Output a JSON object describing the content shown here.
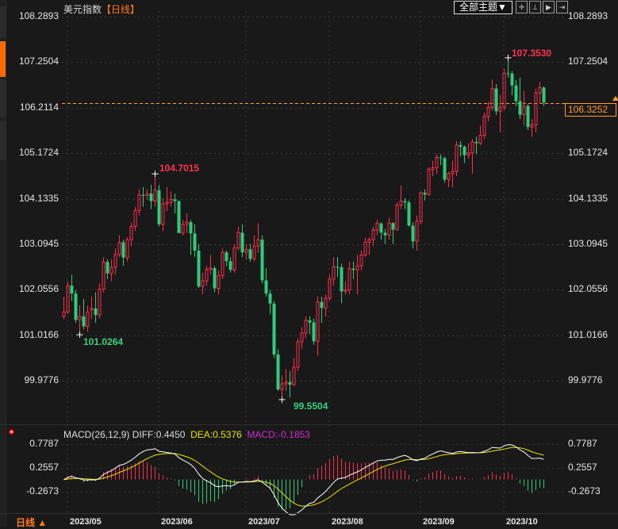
{
  "header": {
    "title": "美元指数",
    "period": "【日线】",
    "theme_button": "全部主题▼",
    "tools": [
      {
        "icon": "crosshair-icon"
      },
      {
        "icon": "fit-range-icon"
      },
      {
        "icon": "play-step-icon"
      },
      {
        "icon": "exit-right-icon"
      }
    ]
  },
  "price_axis": {
    "labels": [
      "108.2893",
      "107.2504",
      "106.2114",
      "105.1724",
      "104.1335",
      "103.0945",
      "102.0556",
      "101.0166",
      "99.9776"
    ]
  },
  "last_price": "106.3252",
  "annotations": {
    "high_may": "104.7015",
    "low_may": "101.0264",
    "low_jul": "99.5504",
    "high_oct": "107.3530"
  },
  "macd": {
    "title": "MACD(26,12,9)",
    "diff": "DIFF:0.4450",
    "dea": "DEA:0.5376",
    "macd": "MACD:-0.1853",
    "axis_labels": [
      "0.7787",
      "0.2557",
      "-0.2673"
    ]
  },
  "dates": {
    "months": [
      "2023/05",
      "2023/06",
      "2023/07",
      "2023/08",
      "2023/09",
      "2023/10"
    ]
  },
  "period_tab": "日线 ▲",
  "colors": {
    "up": "#ff2d4a",
    "down": "#2ecc7a",
    "accent": "#ff7a1a",
    "diff": "#ffffff",
    "dea": "#e6e600",
    "macd": "#d22ad2"
  },
  "chart_data": {
    "type": "candlestick",
    "title": "美元指数",
    "ylim": [
      99.9776,
      108.2893
    ],
    "columns": [
      "open",
      "high",
      "low",
      "close"
    ],
    "candles": [
      [
        101.45,
        101.9,
        101.38,
        101.55
      ],
      [
        101.55,
        102.25,
        101.5,
        102.15
      ],
      [
        102.15,
        102.4,
        101.8,
        101.97
      ],
      [
        101.97,
        102.05,
        101.3,
        101.37
      ],
      [
        101.37,
        101.7,
        101.03,
        101.45
      ],
      [
        101.45,
        101.85,
        101.15,
        101.22
      ],
      [
        101.22,
        101.7,
        101.1,
        101.55
      ],
      [
        101.6,
        101.9,
        101.4,
        101.63
      ],
      [
        101.63,
        102.0,
        101.3,
        101.48
      ],
      [
        101.48,
        102.2,
        101.4,
        102.07
      ],
      [
        102.07,
        102.8,
        102.0,
        102.69
      ],
      [
        102.69,
        102.75,
        102.3,
        102.43
      ],
      [
        102.43,
        102.75,
        102.25,
        102.57
      ],
      [
        102.57,
        103.0,
        102.4,
        102.86
      ],
      [
        102.86,
        103.3,
        102.8,
        103.14
      ],
      [
        103.14,
        103.2,
        102.6,
        102.79
      ],
      [
        102.79,
        103.25,
        102.7,
        103.2
      ],
      [
        103.2,
        103.6,
        103.05,
        103.5
      ],
      [
        103.5,
        103.95,
        103.4,
        103.86
      ],
      [
        103.86,
        104.35,
        103.75,
        104.22
      ],
      [
        104.22,
        104.4,
        103.95,
        104.21
      ],
      [
        104.21,
        104.35,
        104.1,
        104.25
      ],
      [
        104.25,
        104.45,
        103.9,
        104.08
      ],
      [
        104.08,
        104.7,
        103.95,
        104.33
      ],
      [
        104.33,
        104.45,
        103.5,
        103.55
      ],
      [
        103.55,
        104.15,
        103.4,
        104.02
      ],
      [
        104.02,
        104.4,
        103.85,
        104.05
      ],
      [
        104.05,
        104.3,
        103.95,
        104.12
      ],
      [
        104.12,
        104.25,
        103.8,
        104.08
      ],
      [
        104.08,
        104.1,
        103.35,
        103.35
      ],
      [
        103.35,
        103.65,
        103.3,
        103.55
      ],
      [
        103.55,
        103.8,
        103.35,
        103.6
      ],
      [
        103.6,
        103.65,
        102.85,
        103.34
      ],
      [
        103.34,
        103.55,
        102.8,
        102.95
      ],
      [
        102.95,
        103.1,
        102.1,
        102.13
      ],
      [
        102.13,
        102.45,
        101.95,
        102.26
      ],
      [
        102.26,
        102.6,
        102.15,
        102.52
      ],
      [
        102.52,
        102.85,
        102.4,
        102.55
      ],
      [
        102.55,
        102.6,
        102.0,
        102.09
      ],
      [
        102.09,
        102.5,
        101.95,
        102.38
      ],
      [
        102.38,
        103.0,
        102.3,
        102.91
      ],
      [
        102.91,
        102.95,
        102.6,
        102.71
      ],
      [
        102.71,
        102.8,
        102.45,
        102.51
      ],
      [
        102.51,
        103.1,
        102.45,
        103.01
      ],
      [
        103.01,
        103.5,
        102.95,
        103.36
      ],
      [
        103.36,
        103.55,
        102.8,
        102.91
      ],
      [
        102.91,
        103.1,
        102.75,
        102.98
      ],
      [
        102.98,
        103.1,
        102.7,
        102.76
      ],
      [
        102.76,
        103.3,
        102.7,
        103.05
      ],
      [
        103.05,
        103.57,
        102.9,
        103.2
      ],
      [
        103.2,
        103.3,
        102.2,
        102.27
      ],
      [
        102.27,
        102.55,
        101.9,
        101.97
      ],
      [
        101.97,
        102.05,
        101.5,
        101.74
      ],
      [
        101.74,
        101.8,
        100.5,
        100.58
      ],
      [
        100.58,
        100.7,
        99.75,
        99.78
      ],
      [
        99.78,
        100.1,
        99.55,
        99.91
      ],
      [
        99.91,
        100.25,
        99.75,
        99.95
      ],
      [
        99.95,
        100.2,
        99.6,
        99.89
      ],
      [
        99.89,
        100.5,
        99.85,
        100.29
      ],
      [
        100.29,
        100.95,
        100.2,
        100.87
      ],
      [
        100.87,
        101.2,
        100.7,
        101.07
      ],
      [
        101.07,
        101.45,
        100.95,
        101.36
      ],
      [
        101.36,
        101.45,
        101.05,
        101.31
      ],
      [
        101.31,
        101.4,
        100.8,
        100.88
      ],
      [
        100.88,
        101.9,
        100.55,
        101.78
      ],
      [
        101.78,
        101.9,
        101.3,
        101.64
      ],
      [
        101.64,
        101.95,
        101.45,
        101.86
      ],
      [
        101.86,
        102.4,
        101.8,
        102.3
      ],
      [
        102.3,
        102.8,
        102.15,
        102.58
      ],
      [
        102.58,
        102.8,
        102.35,
        102.57
      ],
      [
        102.57,
        102.65,
        101.75,
        102.02
      ],
      [
        102.02,
        102.25,
        101.95,
        102.05
      ],
      [
        102.05,
        102.7,
        101.95,
        102.54
      ],
      [
        102.54,
        102.7,
        102.3,
        102.51
      ],
      [
        102.51,
        102.85,
        101.95,
        102.6
      ],
      [
        102.6,
        102.95,
        102.5,
        102.85
      ],
      [
        102.85,
        103.25,
        102.8,
        103.14
      ],
      [
        103.14,
        103.25,
        102.85,
        103.2
      ],
      [
        103.2,
        103.5,
        103.05,
        103.42
      ],
      [
        103.42,
        103.65,
        103.3,
        103.57
      ],
      [
        103.57,
        103.6,
        103.2,
        103.36
      ],
      [
        103.36,
        103.45,
        103.1,
        103.3
      ],
      [
        103.3,
        103.7,
        103.2,
        103.58
      ],
      [
        103.58,
        103.6,
        103.1,
        103.43
      ],
      [
        103.43,
        104.05,
        103.4,
        103.99
      ],
      [
        103.99,
        104.44,
        103.9,
        104.08
      ],
      [
        104.08,
        104.15,
        103.9,
        104.05
      ],
      [
        104.05,
        104.1,
        103.5,
        103.52
      ],
      [
        103.52,
        103.6,
        103.0,
        103.16
      ],
      [
        103.16,
        103.75,
        102.95,
        103.62
      ],
      [
        103.62,
        104.3,
        103.55,
        104.27
      ],
      [
        104.27,
        104.35,
        104.1,
        104.23
      ],
      [
        104.23,
        104.85,
        104.2,
        104.8
      ],
      [
        104.8,
        105.0,
        104.65,
        104.84
      ],
      [
        104.84,
        105.15,
        104.7,
        105.08
      ],
      [
        105.08,
        105.15,
        104.9,
        105.06
      ],
      [
        105.06,
        105.1,
        104.5,
        104.57
      ],
      [
        104.57,
        104.75,
        104.4,
        104.71
      ],
      [
        104.71,
        105.0,
        104.4,
        104.76
      ],
      [
        104.76,
        105.45,
        104.65,
        105.36
      ],
      [
        105.36,
        105.45,
        105.1,
        105.32
      ],
      [
        105.32,
        105.35,
        104.95,
        105.13
      ],
      [
        105.13,
        105.4,
        105.05,
        105.18
      ],
      [
        105.18,
        105.5,
        104.7,
        105.43
      ],
      [
        105.43,
        105.55,
        105.15,
        105.4
      ],
      [
        105.4,
        105.8,
        105.35,
        105.58
      ],
      [
        105.58,
        106.1,
        105.5,
        106.01
      ],
      [
        106.01,
        106.35,
        105.9,
        106.22
      ],
      [
        106.22,
        106.85,
        106.15,
        106.65
      ],
      [
        106.65,
        106.75,
        106.05,
        106.13
      ],
      [
        106.13,
        106.5,
        105.65,
        106.22
      ],
      [
        106.22,
        107.1,
        106.15,
        107.0
      ],
      [
        107.0,
        107.35,
        106.9,
        106.99
      ],
      [
        106.99,
        107.05,
        106.5,
        106.72
      ],
      [
        106.72,
        106.85,
        106.25,
        106.36
      ],
      [
        106.36,
        106.9,
        105.95,
        106.05
      ],
      [
        106.05,
        106.6,
        105.8,
        106.25
      ],
      [
        106.25,
        106.3,
        105.7,
        105.77
      ],
      [
        105.77,
        105.95,
        105.55,
        105.82
      ],
      [
        105.82,
        106.65,
        105.65,
        106.55
      ],
      [
        106.55,
        106.8,
        106.3,
        106.67
      ],
      [
        106.67,
        106.7,
        106.25,
        106.33
      ]
    ],
    "macd_ylim": [
      -0.2673,
      0.7787
    ]
  }
}
